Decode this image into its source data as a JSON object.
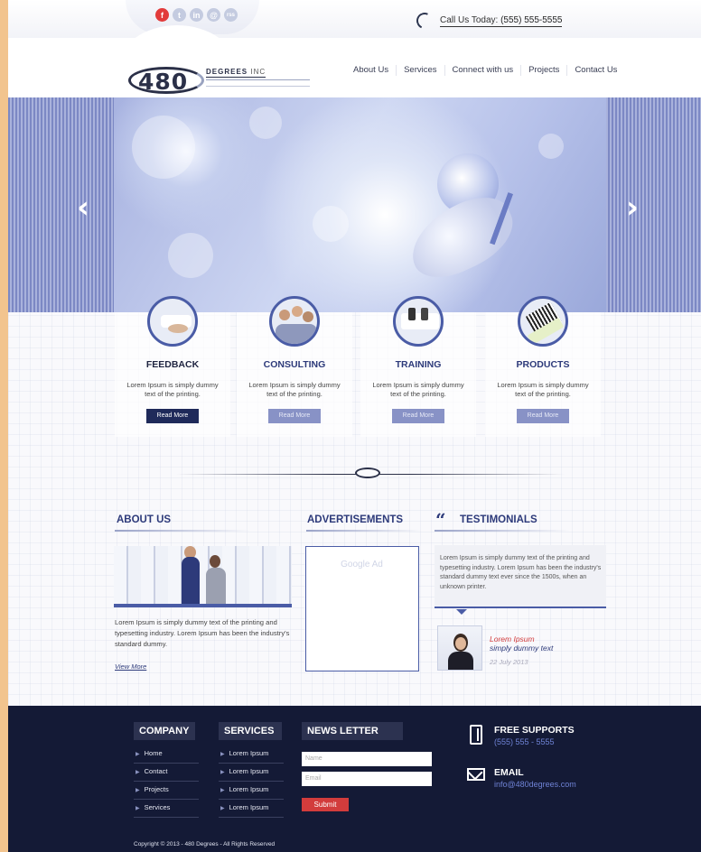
{
  "topbar": {
    "social_icons": [
      "facebook-icon",
      "twitter-icon",
      "linkedin-icon",
      "email-icon",
      "rss-icon"
    ],
    "social_glyphs": [
      "f",
      "t",
      "in",
      "@",
      "rss"
    ],
    "call_label": "Call Us Today:",
    "call_number": "(555) 555-5555"
  },
  "header": {
    "logo_number": "480",
    "logo_text": "DEGREES",
    "logo_suffix": "INC",
    "nav": [
      "About Us",
      "Services",
      "Connect with us",
      "Projects",
      "Contact Us"
    ]
  },
  "slider": {
    "prev_arrow": "‹",
    "next_arrow": "›"
  },
  "services": [
    {
      "title": "FEEDBACK",
      "text": "Lorem Ipsum is simply dummy text of the printing.",
      "button": "Read More"
    },
    {
      "title": "CONSULTING",
      "text": "Lorem Ipsum is simply dummy text of the printing.",
      "button": "Read More"
    },
    {
      "title": "TRAINING",
      "text": "Lorem Ipsum is simply dummy text of the printing.",
      "button": "Read More"
    },
    {
      "title": "PRODUCTS",
      "text": "Lorem Ipsum is simply dummy text of the printing.",
      "button": "Read More"
    }
  ],
  "about": {
    "heading": "ABOUT US",
    "text": "Lorem Ipsum is simply dummy text of the printing and typesetting industry. Lorem Ipsum has been the industry's standard dummy.",
    "link": "View More"
  },
  "ads": {
    "heading": "ADVERTISEMENTS",
    "placeholder": "Google Ad"
  },
  "testimonials": {
    "heading": "TESTIMONIALS",
    "quote": "Lorem Ipsum is simply dummy text of the printing and typesetting industry. Lorem Ipsum has been the industry's standard dummy text ever since the 1500s, when an unknown printer.",
    "name": "Lorem Ipsum",
    "subtitle": "simply dummy text",
    "date": "22 July 2013"
  },
  "footer": {
    "company": {
      "heading": "COMPANY",
      "links": [
        "Home",
        "Contact",
        "Projects",
        "Services"
      ]
    },
    "services": {
      "heading": "SERVICES",
      "links": [
        "Lorem Ipsum",
        "Lorem Ipsum",
        "Lorem Ipsum",
        "Lorem Ipsum"
      ]
    },
    "newsletter": {
      "heading": "NEWS LETTER",
      "name_placeholder": "Name",
      "email_placeholder": "Email",
      "submit": "Submit"
    },
    "support": {
      "title": "FREE SUPPORTS",
      "phone": "(555) 555 - 5555"
    },
    "email": {
      "title": "EMAIL",
      "address": "info@480degrees.com"
    },
    "copyright": "Copyright © 2013 - 480 Degrees - All Rights Reserved"
  },
  "colors": {
    "accent": "#2d3a7a",
    "brand_dark": "#141a36",
    "submit": "#d23c3c",
    "page_bg": "#f2c48e"
  }
}
